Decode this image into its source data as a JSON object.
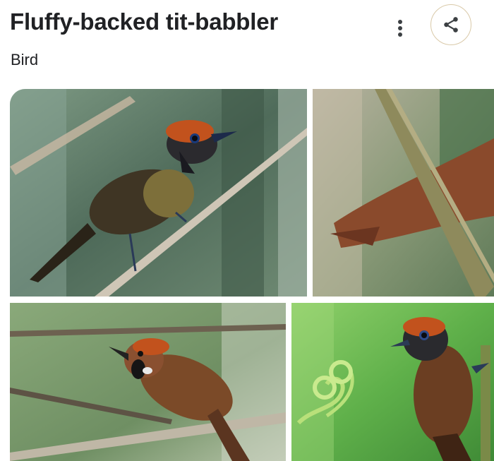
{
  "entity": {
    "title": "Fluffy-backed tit-babbler",
    "type": "Bird"
  },
  "actions": {
    "more_icon": "more-vert-icon",
    "share_icon": "share-icon"
  },
  "colors": {
    "share_border": "#d9c9a8",
    "icon": "#3c4043"
  },
  "images": [
    {
      "subject": "bird perched on diagonal branch"
    },
    {
      "subject": "bird partially hidden behind branch"
    },
    {
      "subject": "bird on horizontal branch"
    },
    {
      "subject": "bird beside fern fiddleheads"
    }
  ]
}
